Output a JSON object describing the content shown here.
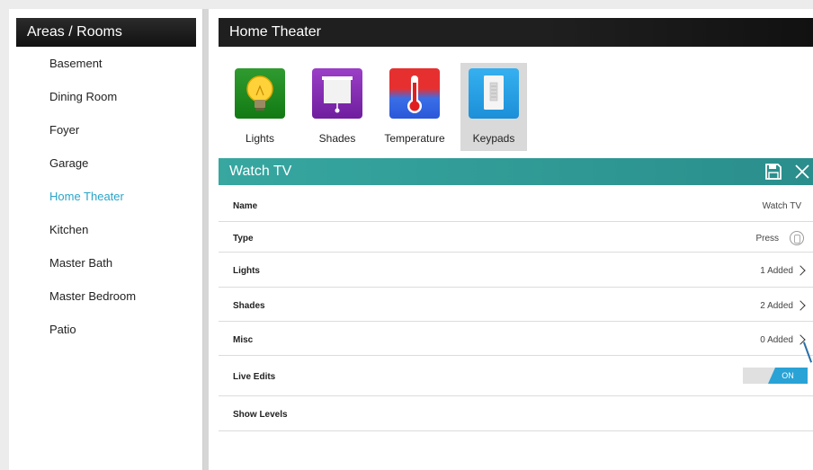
{
  "left": {
    "title": "Areas / Rooms",
    "rooms": [
      {
        "label": "Basement"
      },
      {
        "label": "Dining Room"
      },
      {
        "label": "Foyer"
      },
      {
        "label": "Garage"
      },
      {
        "label": "Home Theater",
        "active": true
      },
      {
        "label": "Kitchen"
      },
      {
        "label": "Master Bath"
      },
      {
        "label": "Master Bedroom"
      },
      {
        "label": "Patio"
      }
    ]
  },
  "right": {
    "title": "Home Theater",
    "devices": [
      {
        "label": "Lights",
        "icon": "lightbulb-icon",
        "color": "#1f8c1f"
      },
      {
        "label": "Shades",
        "icon": "shades-icon",
        "color": "#8a2fbf"
      },
      {
        "label": "Temperature",
        "icon": "thermometer-icon",
        "color": "#e63030"
      },
      {
        "label": "Keypads",
        "icon": "keypad-icon",
        "color": "#2a9fe6",
        "active": true
      }
    ]
  },
  "scene": {
    "title": "Watch TV",
    "save_icon": "save-icon",
    "close_icon": "close-icon",
    "rows": {
      "name": {
        "label": "Name",
        "value": "Watch TV"
      },
      "type": {
        "label": "Type",
        "value": "Press"
      },
      "lights": {
        "label": "Lights",
        "value": "1 Added"
      },
      "shades": {
        "label": "Shades",
        "value": "2 Added"
      },
      "misc": {
        "label": "Misc",
        "value": "0 Added"
      },
      "live_edits": {
        "label": "Live Edits",
        "toggle": "ON"
      },
      "show_levels": {
        "label": "Show Levels"
      }
    }
  },
  "colors": {
    "accent": "#2aa5c8",
    "scene_header": "#2f9a96",
    "toggle_on": "#29a3d6"
  }
}
